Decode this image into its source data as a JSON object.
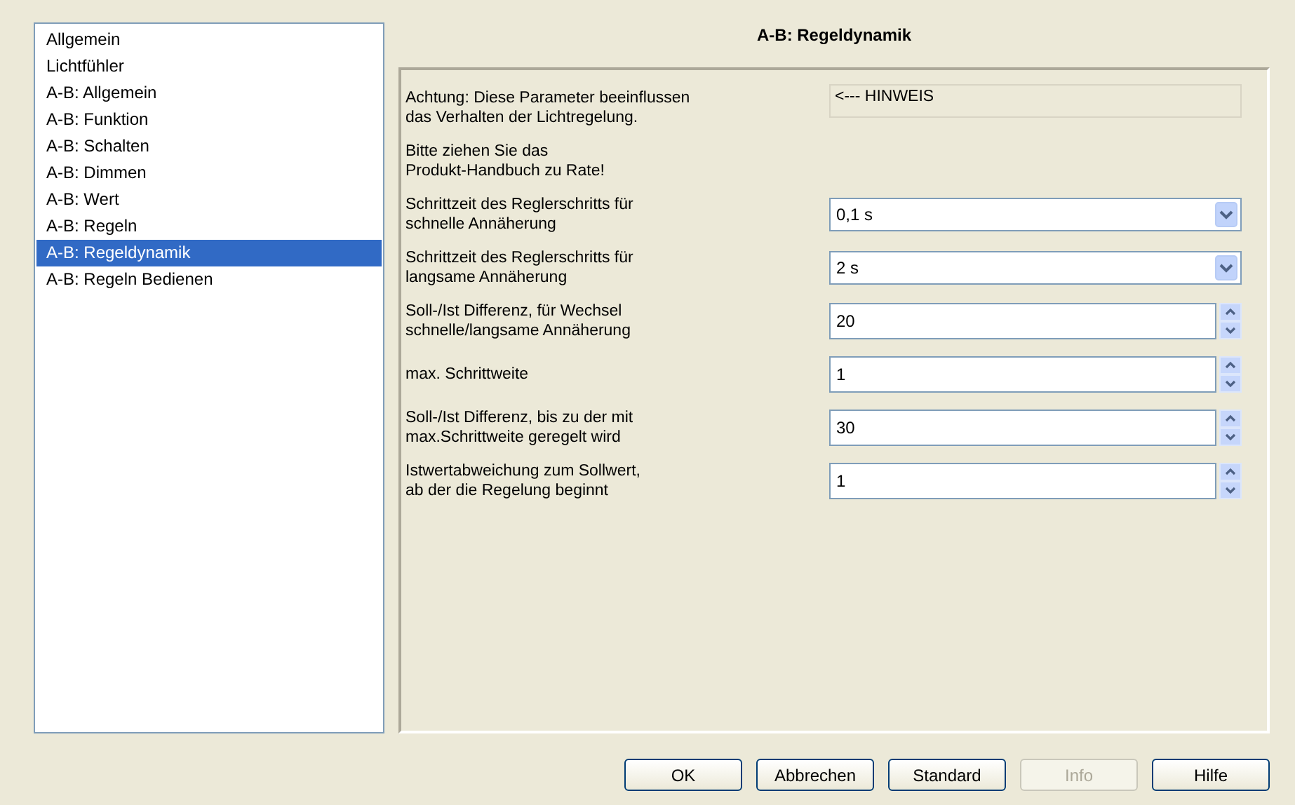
{
  "sidebar": {
    "items": [
      {
        "label": "Allgemein",
        "selected": false
      },
      {
        "label": "Lichtfühler",
        "selected": false
      },
      {
        "label": "A-B: Allgemein",
        "selected": false
      },
      {
        "label": "A-B: Funktion",
        "selected": false
      },
      {
        "label": "A-B: Schalten",
        "selected": false
      },
      {
        "label": "A-B: Dimmen",
        "selected": false
      },
      {
        "label": "A-B: Wert",
        "selected": false
      },
      {
        "label": "A-B: Regeln",
        "selected": false
      },
      {
        "label": "A-B: Regeldynamik",
        "selected": true
      },
      {
        "label": "A-B: Regeln Bedienen",
        "selected": false
      }
    ]
  },
  "page_title": "A-B: Regeldynamik",
  "parameters": [
    {
      "kind": "note",
      "label": [
        "Achtung: Diese Parameter beeinflussen",
        "das Verhalten der Lichtregelung."
      ],
      "value": "<--- HINWEIS"
    },
    {
      "kind": "text",
      "label": [
        "Bitte ziehen Sie das",
        "Produkt-Handbuch zu Rate!"
      ]
    },
    {
      "kind": "dropdown",
      "label": [
        "Schrittzeit des Reglerschritts für",
        "schnelle Annäherung"
      ],
      "value": "0,1 s"
    },
    {
      "kind": "dropdown",
      "label": [
        "Schrittzeit des Reglerschritts für",
        "langsame Annäherung"
      ],
      "value": "2 s"
    },
    {
      "kind": "spinner",
      "label": [
        "Soll-/Ist Differenz, für Wechsel",
        "schnelle/langsame Annäherung"
      ],
      "value": "20"
    },
    {
      "kind": "spinner",
      "label": [
        "max. Schrittweite"
      ],
      "value": "1"
    },
    {
      "kind": "spinner",
      "label": [
        "Soll-/Ist Differenz, bis zu der mit",
        "max.Schrittweite geregelt wird"
      ],
      "value": "30"
    },
    {
      "kind": "spinner",
      "label": [
        "Istwertabweichung zum Sollwert,",
        "ab der die Regelung beginnt"
      ],
      "value": "1"
    }
  ],
  "buttons": [
    {
      "label": "OK",
      "disabled": false
    },
    {
      "label": "Abbrechen",
      "disabled": false
    },
    {
      "label": "Standard",
      "disabled": false
    },
    {
      "label": "Info",
      "disabled": true
    },
    {
      "label": "Hilfe",
      "disabled": false
    }
  ]
}
